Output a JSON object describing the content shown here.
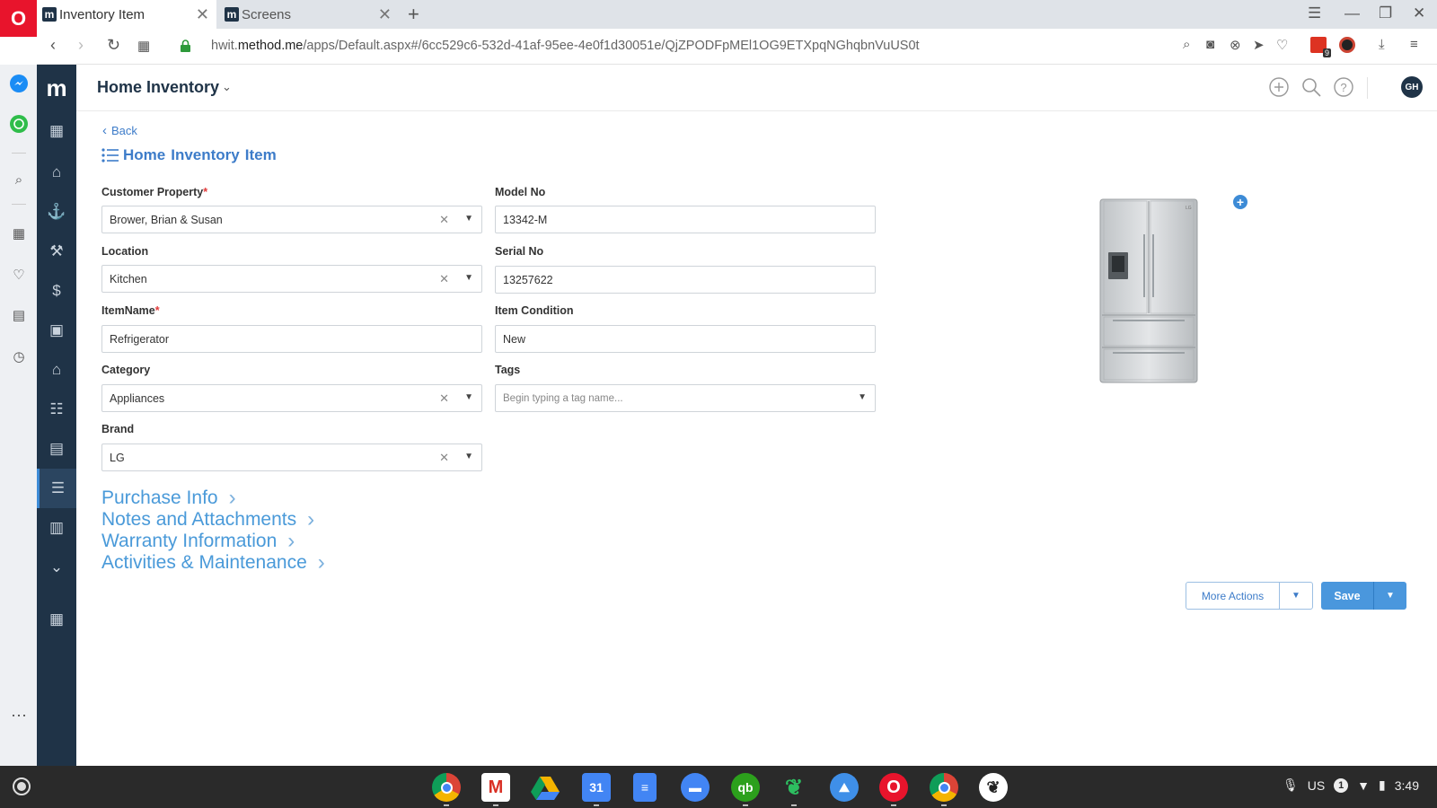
{
  "browser": {
    "tabs": [
      {
        "label": "Inventory Item",
        "favicon": "m"
      },
      {
        "label": "Screens",
        "favicon": "m"
      }
    ],
    "url_host": "hwit.method.me",
    "url_prefix": "hwit.",
    "url_domain": "method.me",
    "url_path": "/apps/Default.aspx#/6cc529c6-532d-41af-95ee-4e0f1d30051e/QjZPODFpMEl1OG9ETXpqNGhqbnVuUS0t",
    "extension_badge": "9"
  },
  "app": {
    "logo": "m",
    "title": "Home Inventory",
    "avatar_initials": "GH"
  },
  "page": {
    "back_label": "Back",
    "title_words": [
      "Home",
      "Inventory",
      "Item"
    ]
  },
  "form": {
    "customer_property": {
      "label": "Customer Property",
      "required": "*",
      "value": "Brower, Brian & Susan"
    },
    "location": {
      "label": "Location",
      "value": "Kitchen"
    },
    "item_name": {
      "label": "ItemName",
      "required": "*",
      "value": "Refrigerator"
    },
    "category": {
      "label": "Category",
      "value": "Appliances"
    },
    "brand": {
      "label": "Brand",
      "value": "LG"
    },
    "model_no": {
      "label": "Model No",
      "value": "13342-M"
    },
    "serial_no": {
      "label": "Serial No",
      "value": "13257622"
    },
    "item_condition": {
      "label": "Item Condition",
      "value": "New"
    },
    "tags": {
      "label": "Tags",
      "placeholder": "Begin typing a tag name..."
    }
  },
  "sections": [
    {
      "label": "Purchase Info"
    },
    {
      "label": "Notes and Attachments"
    },
    {
      "label": "Warranty Information"
    },
    {
      "label": "Activities & Maintenance"
    }
  ],
  "actions": {
    "more_actions": "More Actions",
    "save": "Save"
  },
  "shelf": {
    "calendar_day": "31",
    "locale": "US",
    "notification_count": "1",
    "time": "3:49"
  },
  "colors": {
    "nav_bg": "#1f3347",
    "accent": "#3d7cc9",
    "section_link": "#4a9ad9",
    "save_bg": "#4a97dd",
    "opera_red": "#e8142c"
  }
}
